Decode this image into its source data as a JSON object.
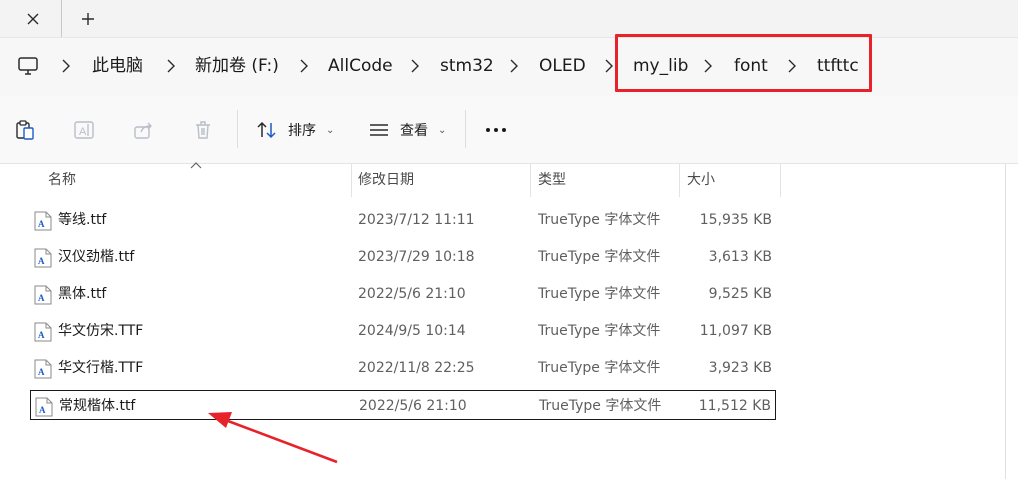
{
  "breadcrumb": {
    "items": [
      {
        "label": "此电脑"
      },
      {
        "label": "新加卷 (F:)"
      },
      {
        "label": "AllCode"
      },
      {
        "label": "stm32"
      },
      {
        "label": "OLED"
      },
      {
        "label": "my_lib"
      },
      {
        "label": "font"
      },
      {
        "label": "ttfttc"
      }
    ]
  },
  "toolbar": {
    "sort_label": "排序",
    "view_label": "查看",
    "icons": [
      "clipboard-icon",
      "rename-icon",
      "share-icon",
      "delete-icon",
      "sort-icon",
      "view-icon",
      "more-icon"
    ]
  },
  "columns": {
    "name": "名称",
    "modified": "修改日期",
    "type": "类型",
    "size": "大小"
  },
  "files": [
    {
      "name": "等线.ttf",
      "modified": "2023/7/12 11:11",
      "type": "TrueType 字体文件",
      "size": "15,935 KB",
      "selected": false
    },
    {
      "name": "汉仪劲楷.ttf",
      "modified": "2023/7/29 10:18",
      "type": "TrueType 字体文件",
      "size": "3,613 KB",
      "selected": false
    },
    {
      "name": "黑体.ttf",
      "modified": "2022/5/6 21:10",
      "type": "TrueType 字体文件",
      "size": "9,525 KB",
      "selected": false
    },
    {
      "name": "华文仿宋.TTF",
      "modified": "2024/9/5 10:14",
      "type": "TrueType 字体文件",
      "size": "11,097 KB",
      "selected": false
    },
    {
      "name": "华文行楷.TTF",
      "modified": "2022/11/8 22:25",
      "type": "TrueType 字体文件",
      "size": "3,923 KB",
      "selected": false
    },
    {
      "name": "常规楷体.ttf",
      "modified": "2022/5/6 21:10",
      "type": "TrueType 字体文件",
      "size": "11,512 KB",
      "selected": true
    }
  ],
  "colors": {
    "annotation_red": "#e8222a",
    "accent_blue": "#1e5bc6"
  }
}
